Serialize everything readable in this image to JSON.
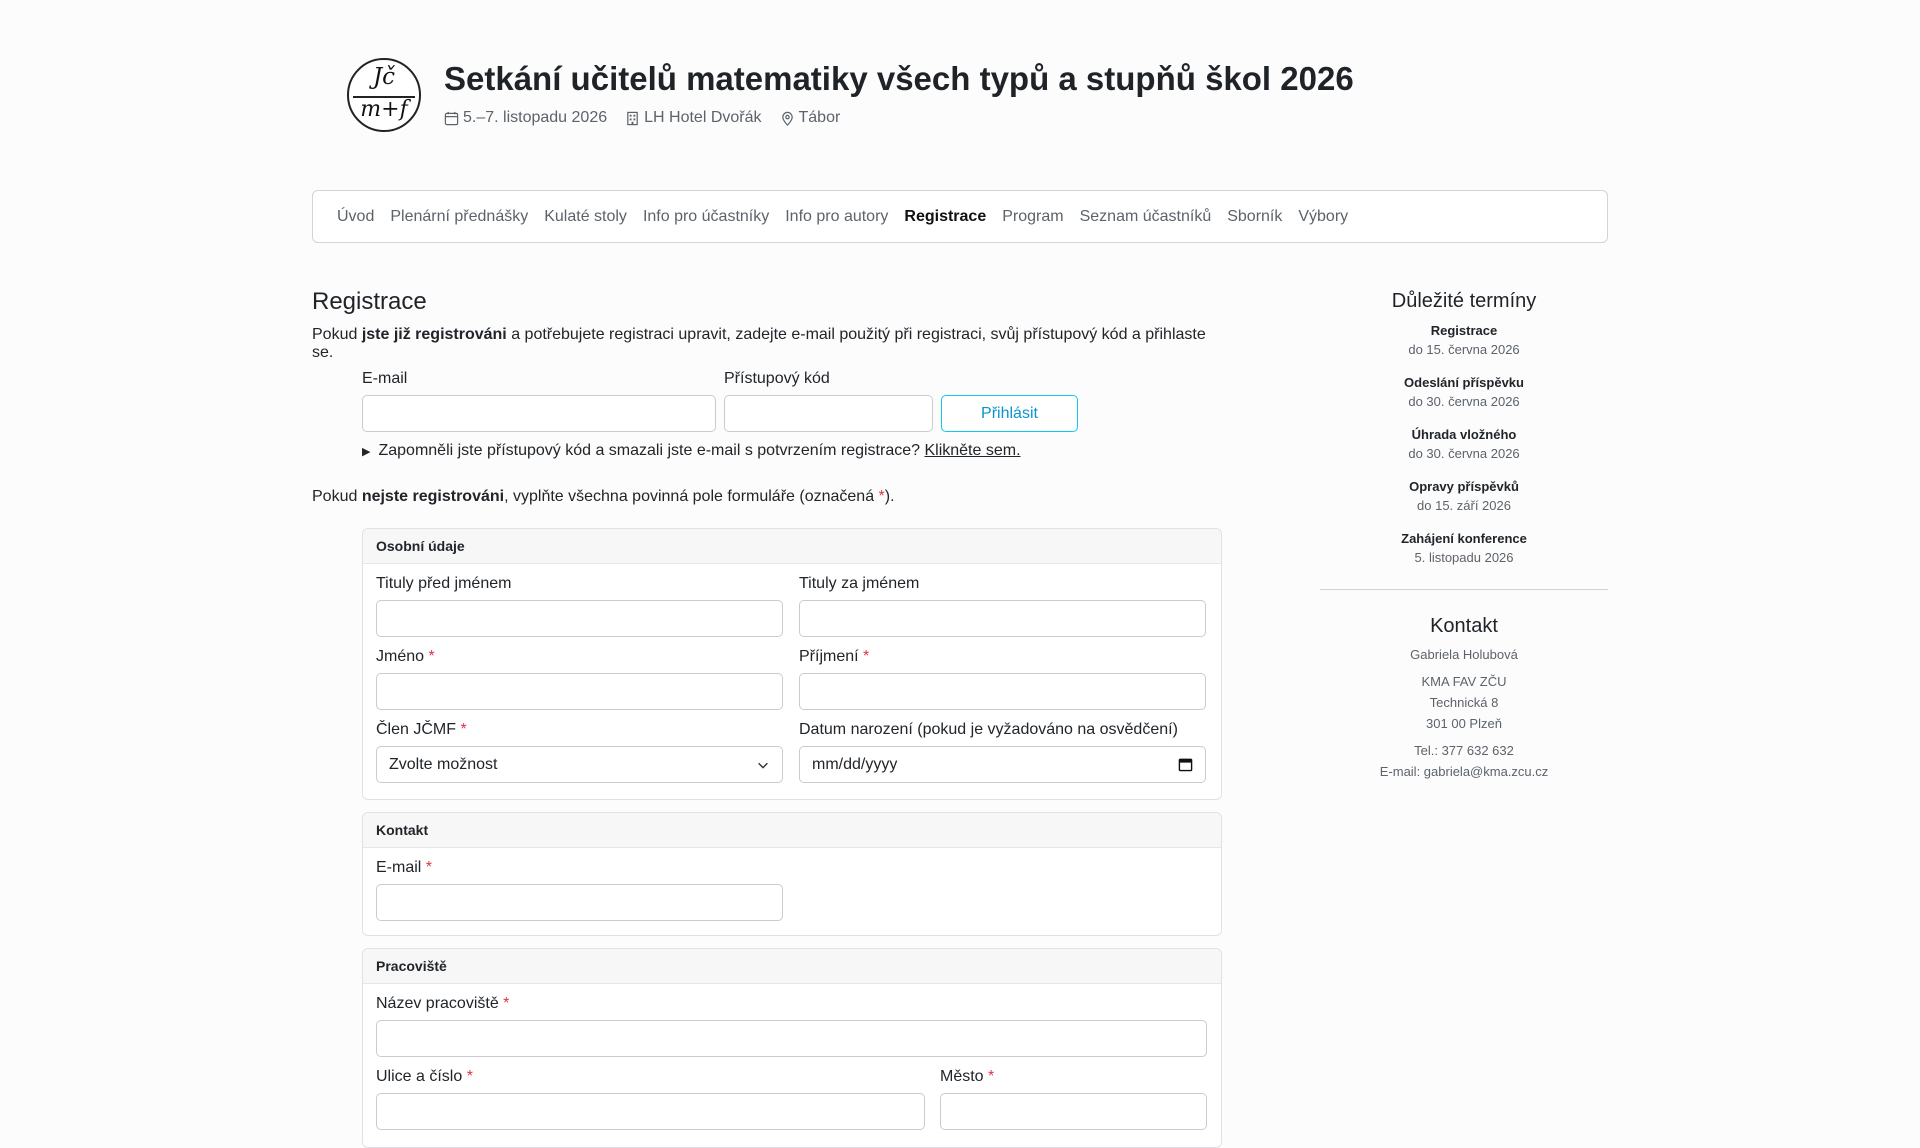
{
  "logo": {
    "line1": "Jč",
    "line2": "m+f"
  },
  "header": {
    "title": "Setkání učitelů matematiky všech typů a stupňů škol 2026",
    "dates": "5.–7. listopadu 2026",
    "venue": "LH Hotel Dvořák",
    "city": "Tábor"
  },
  "nav": {
    "items": [
      {
        "label": "Úvod"
      },
      {
        "label": "Plenární přednášky"
      },
      {
        "label": "Kulaté stoly"
      },
      {
        "label": "Info pro účastníky"
      },
      {
        "label": "Info pro autory"
      },
      {
        "label": "Registrace"
      },
      {
        "label": "Program"
      },
      {
        "label": "Seznam účastníků"
      },
      {
        "label": "Sborník"
      },
      {
        "label": "Výbory"
      }
    ],
    "active": "Registrace"
  },
  "main": {
    "heading": "Registrace",
    "intro_pre": "Pokud ",
    "intro_bold": "jste již registrováni",
    "intro_post": " a potřebujete registraci upravit, zadejte e-mail použitý při registraci, svůj přístupový kód a přihlaste se.",
    "login": {
      "email_label": "E-mail",
      "email_value": "",
      "code_label": "Přístupový kód",
      "code_value": "",
      "button": "Přihlásit"
    },
    "forgot_text": "Zapomněli jste přístupový kód a smazali jste e-mail s potvrzením registrace?",
    "forgot_link": "Klikněte sem.",
    "notreg_pre": "Pokud ",
    "notreg_bold": "nejste registrováni",
    "notreg_post": ", vyplňte všechna povinná pole formuláře (označená ",
    "notreg_star": "*",
    "notreg_end": ")."
  },
  "form": {
    "required_mark": "*",
    "personal": {
      "title": "Osobní údaje",
      "titles_before": "Tituly před jménem",
      "titles_after": "Tituly za jménem",
      "first_name": "Jméno",
      "last_name": "Příjmení",
      "member": "Člen JČMF",
      "member_value": "Zvolte možnost",
      "birth": "Datum narození (pokud je vyžadováno na osvědčení)",
      "birth_placeholder": "mm/dd/yyyy"
    },
    "contact": {
      "title": "Kontakt",
      "email": "E-mail"
    },
    "workplace": {
      "title": "Pracoviště",
      "name": "Název pracoviště",
      "street": "Ulice a číslo",
      "city": "Město"
    }
  },
  "sidebar": {
    "deadlines_title": "Důležité termíny",
    "deadlines": [
      {
        "label": "Registrace",
        "date": "do 15. června 2026"
      },
      {
        "label": "Odeslání příspěvku",
        "date": "do 30. června 2026"
      },
      {
        "label": "Úhrada vložného",
        "date": "do 30. června 2026"
      },
      {
        "label": "Opravy příspěvků",
        "date": "do 15. září 2026"
      },
      {
        "label": "Zahájení konference",
        "date": "5. listopadu 2026"
      }
    ],
    "contact_title": "Kontakt",
    "contact_name": "Gabriela Holubová",
    "addr1": "KMA FAV ZČU",
    "addr2": "Technická 8",
    "addr3": "301 00 Plzeň",
    "tel": "Tel.: 377 632 632",
    "email": "E-mail: gabriela@kma.zcu.cz"
  },
  "colors": {
    "accent": "#0dcaf0",
    "required": "#dc3545"
  }
}
